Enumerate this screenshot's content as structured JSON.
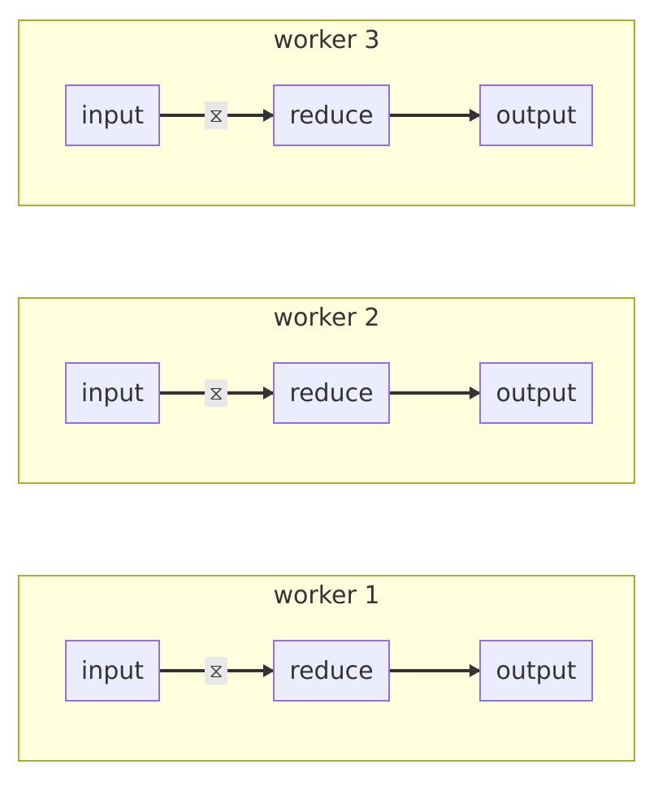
{
  "diagram": {
    "type": "flowchart",
    "colors": {
      "cluster_fill": "#ffffde",
      "cluster_border": "#aaaa33",
      "node_fill": "#ececff",
      "node_border": "#9370db",
      "edge": "#333333",
      "edge_label_bg": "#e8e8e8",
      "text": "#333333"
    },
    "clusters": [
      {
        "title": "worker 3",
        "nodes": [
          "input",
          "reduce",
          "output"
        ],
        "edges": [
          {
            "from": "input",
            "to": "reduce",
            "label": "⧖"
          },
          {
            "from": "reduce",
            "to": "output",
            "label": ""
          }
        ]
      },
      {
        "title": "worker 2",
        "nodes": [
          "input",
          "reduce",
          "output"
        ],
        "edges": [
          {
            "from": "input",
            "to": "reduce",
            "label": "⧖"
          },
          {
            "from": "reduce",
            "to": "output",
            "label": ""
          }
        ]
      },
      {
        "title": "worker 1",
        "nodes": [
          "input",
          "reduce",
          "output"
        ],
        "edges": [
          {
            "from": "input",
            "to": "reduce",
            "label": "⧖"
          },
          {
            "from": "reduce",
            "to": "output",
            "label": ""
          }
        ]
      }
    ]
  }
}
